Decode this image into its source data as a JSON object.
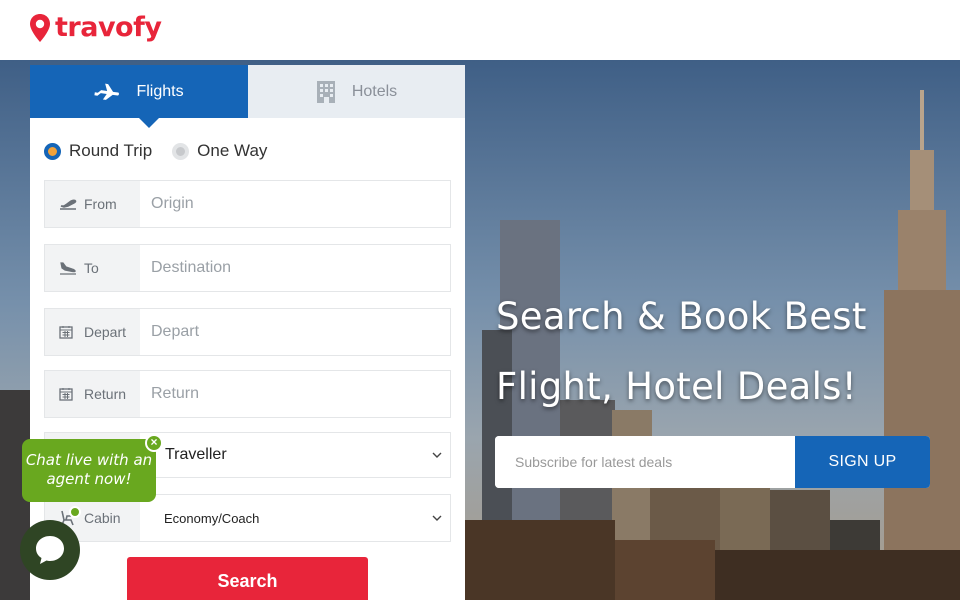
{
  "brand": {
    "name": "travofy",
    "color": "#e8253a"
  },
  "tabs": [
    {
      "label": "Flights",
      "icon": "airplane-icon",
      "active": true
    },
    {
      "label": "Hotels",
      "icon": "building-icon",
      "active": false
    }
  ],
  "trip_type": {
    "options": [
      "Round Trip",
      "One Way"
    ],
    "selected": "Round Trip"
  },
  "fields": {
    "from": {
      "label": "From",
      "placeholder": "Origin",
      "icon": "takeoff-icon"
    },
    "to": {
      "label": "To",
      "placeholder": "Destination",
      "icon": "landing-icon"
    },
    "depart": {
      "label": "Depart",
      "placeholder": "Depart",
      "icon": "calendar-icon"
    },
    "return": {
      "label": "Return",
      "placeholder": "Return",
      "icon": "calendar-icon"
    },
    "traveller": {
      "value": "Traveller"
    },
    "cabin": {
      "label": "Cabin",
      "value": "Economy/Coach",
      "icon": "seat-icon"
    }
  },
  "search_button": "Search",
  "hero": {
    "headline_line1": "Search & Book Best",
    "headline_line2": "Flight, Hotel Deals!"
  },
  "subscribe": {
    "placeholder": "Subscribe for latest deals",
    "button": "SIGN UP"
  },
  "chat": {
    "line1": "Chat live with an",
    "line2": "agent now!",
    "close": "×"
  },
  "colors": {
    "primary": "#1565b7",
    "accent": "#e8253a",
    "chat": "#69a81f"
  }
}
